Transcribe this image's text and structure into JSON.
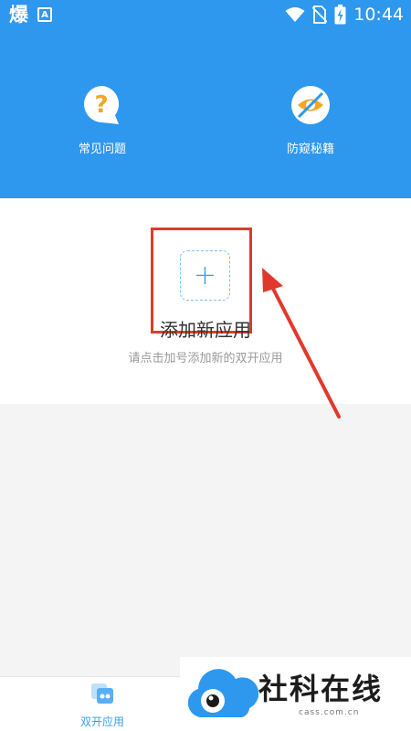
{
  "status_bar": {
    "left_icons": [
      "爆",
      "A"
    ],
    "time": "10:44",
    "icons": [
      "wifi-icon",
      "no-sim-icon",
      "battery-charging-icon"
    ]
  },
  "features": [
    {
      "label": "常见问题",
      "icon": "faq-bubble-icon",
      "icon_color": "#f5a623"
    },
    {
      "label": "防窥秘籍",
      "icon": "eye-slash-icon",
      "icon_color": "#f5a623"
    }
  ],
  "add_app": {
    "plus": "+",
    "title": "添加新应用",
    "subtitle": "请点击加号添加新的双开应用"
  },
  "tabbar": {
    "tabs": [
      {
        "label": "双开应用",
        "active": true
      }
    ]
  },
  "watermark": {
    "brand": "社科在线",
    "url": "cass.com.cn"
  },
  "colors": {
    "header_bg": "#2e98ef",
    "accent": "#3a9ded",
    "highlight": "#e0392b"
  }
}
